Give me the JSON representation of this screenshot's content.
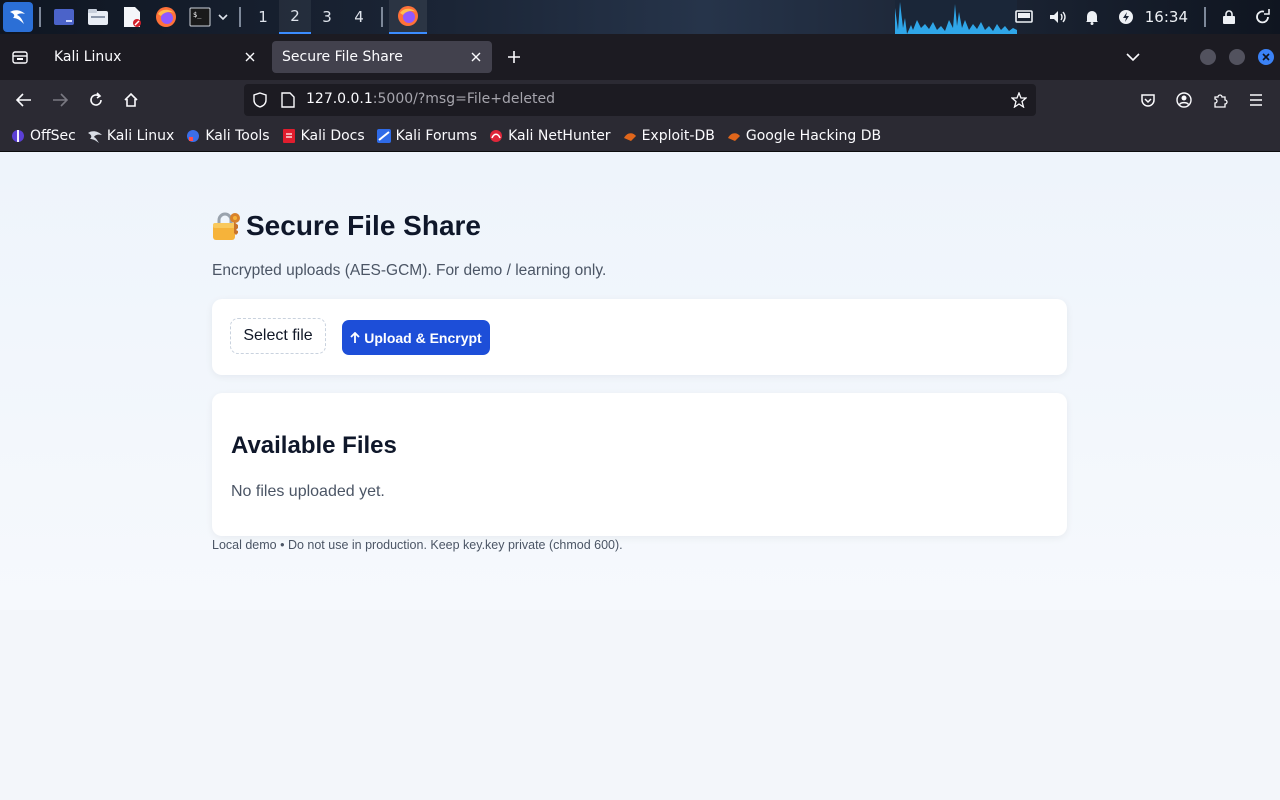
{
  "panel": {
    "workspaces": [
      "1",
      "2",
      "3",
      "4"
    ],
    "active_workspace": "2",
    "clock": "16:34",
    "launchers": [
      "kali-menu-icon",
      "desktop-icon",
      "file-manager-icon",
      "text-editor-icon",
      "firefox-icon",
      "terminal-icon"
    ],
    "tray_icons": [
      "display-icon",
      "volume-icon",
      "notification-bell-icon",
      "power-icon",
      "lock-icon",
      "logout-icon"
    ]
  },
  "browser": {
    "tabs": [
      {
        "label": "Kali Linux",
        "active": false
      },
      {
        "label": "Secure File Share",
        "active": true
      }
    ],
    "url": {
      "host": "127.0.0.1",
      "rest": ":5000/?msg=File+deleted"
    },
    "bookmarks": [
      {
        "label": "OffSec",
        "icon": "offsec-icon"
      },
      {
        "label": "Kali Linux",
        "icon": "kali-dragon-icon"
      },
      {
        "label": "Kali Tools",
        "icon": "kali-tools-icon"
      },
      {
        "label": "Kali Docs",
        "icon": "kali-docs-icon"
      },
      {
        "label": "Kali Forums",
        "icon": "kali-forums-icon"
      },
      {
        "label": "Kali NetHunter",
        "icon": "nethunter-icon"
      },
      {
        "label": "Exploit-DB",
        "icon": "exploit-db-icon"
      },
      {
        "label": "Google Hacking DB",
        "icon": "ghdb-icon"
      }
    ]
  },
  "page": {
    "title": "Secure File Share",
    "subtitle": "Encrypted uploads (AES-GCM). For demo / learning only.",
    "upload": {
      "select_label": "Select file",
      "button_label": "Upload & Encrypt"
    },
    "files": {
      "heading": "Available Files",
      "empty_text": "No files uploaded yet."
    },
    "footer": "Local demo • Do not use in production. Keep key.key private (chmod 600)."
  },
  "colors": {
    "accent": "#1d4ed8",
    "panel_highlight": "#3b8cff",
    "page_bg": "#eef4fb"
  }
}
